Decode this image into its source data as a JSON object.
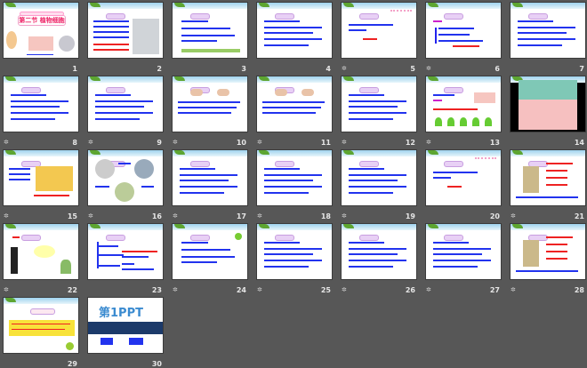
{
  "view": "slide-sorter",
  "slides": [
    {
      "number": "1",
      "animation": false,
      "variant": "cover",
      "title": "第二节 植物细胞"
    },
    {
      "number": "2",
      "animation": false,
      "variant": "text-photo"
    },
    {
      "number": "3",
      "animation": false,
      "variant": "list-grass"
    },
    {
      "number": "4",
      "animation": false,
      "variant": "list"
    },
    {
      "number": "5",
      "animation": true,
      "variant": "flower-text"
    },
    {
      "number": "6",
      "animation": true,
      "variant": "bracket"
    },
    {
      "number": "7",
      "animation": false,
      "variant": "list"
    },
    {
      "number": "8",
      "animation": true,
      "variant": "text"
    },
    {
      "number": "9",
      "animation": true,
      "variant": "text"
    },
    {
      "number": "10",
      "animation": true,
      "variant": "hands"
    },
    {
      "number": "11",
      "animation": true,
      "variant": "hands"
    },
    {
      "number": "12",
      "animation": true,
      "variant": "text"
    },
    {
      "number": "13",
      "animation": true,
      "variant": "plants"
    },
    {
      "number": "14",
      "animation": false,
      "variant": "video"
    },
    {
      "number": "15",
      "animation": true,
      "variant": "cells"
    },
    {
      "number": "16",
      "animation": true,
      "variant": "circles"
    },
    {
      "number": "17",
      "animation": true,
      "variant": "text"
    },
    {
      "number": "18",
      "animation": true,
      "variant": "list"
    },
    {
      "number": "19",
      "animation": true,
      "variant": "text"
    },
    {
      "number": "20",
      "animation": false,
      "variant": "flower-text"
    },
    {
      "number": "21",
      "animation": true,
      "variant": "diagram"
    },
    {
      "number": "22",
      "animation": true,
      "variant": "thinker"
    },
    {
      "number": "23",
      "animation": false,
      "variant": "mindmap"
    },
    {
      "number": "24",
      "animation": true,
      "variant": "list-frog"
    },
    {
      "number": "25",
      "animation": true,
      "variant": "list"
    },
    {
      "number": "26",
      "animation": true,
      "variant": "list"
    },
    {
      "number": "27",
      "animation": true,
      "variant": "list"
    },
    {
      "number": "28",
      "animation": true,
      "variant": "diagram"
    },
    {
      "number": "29",
      "animation": false,
      "variant": "quote"
    },
    {
      "number": "30",
      "animation": false,
      "variant": "brand",
      "title": "第1PPT"
    }
  ],
  "animation_icon": "animation-star-icon"
}
